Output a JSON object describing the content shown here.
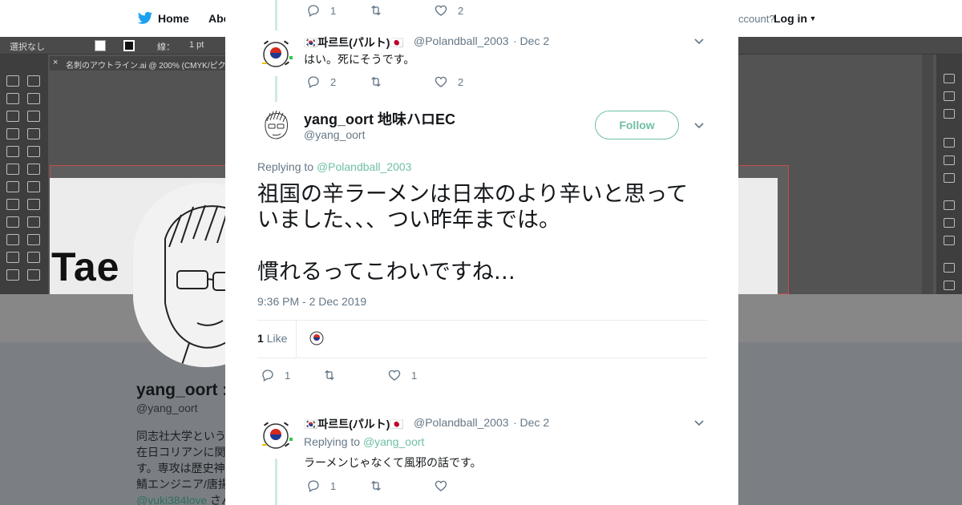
{
  "background": {
    "nav": {
      "home": "Home",
      "about": "Abo",
      "account_prompt": "ccount?",
      "login": "Log in"
    },
    "illustrator": {
      "option_label": "選択なし",
      "stroke_label": "線：",
      "stroke_value": "1 pt",
      "doc_tab": "名刺のアウトライン.ai @ 200% (CMYK/ピクセ",
      "art_text": "Tae"
    },
    "profile": {
      "name": "yang_oort :",
      "handle": "@yang_oort",
      "bio_lines": [
        "同志社大学という",
        "在日コリアンに関",
        "す。専攻は歴史神",
        "鯖エンジニア/唐揚"
      ],
      "bio_link": "@yuki384love",
      "bio_link_suffix": " さん"
    }
  },
  "modal": {
    "top_actions": {
      "replies": "1",
      "likes": "2"
    },
    "reply1": {
      "name": "🇰🇷파르트(パルト)🇯🇵",
      "handle": "@Polandball_2003",
      "date": "· Dec 2",
      "text": "はい。死にそうです。",
      "replies": "2",
      "likes": "2"
    },
    "main": {
      "name": "yang_oort 地味ハロEC",
      "handle": "@yang_oort",
      "follow": "Follow",
      "replying_prefix": "Replying to ",
      "replying_to": "@Polandball_2003",
      "text_line1": "祖国の辛ラーメンは日本のより辛いと思って",
      "text_line2": "いました、、、つい昨年までは。",
      "text_line3": "慣れるってこわいですね…",
      "timestamp": "9:36 PM - 2 Dec 2019",
      "like_count": "1",
      "like_label": "Like",
      "replies": "1",
      "likes": "1"
    },
    "reply2": {
      "name": "🇰🇷파르트(パルト)🇯🇵",
      "handle": "@Polandball_2003",
      "date": "· Dec 2",
      "replying_prefix": "Replying to ",
      "replying_to": "@yang_oort",
      "text": "ラーメンじゃなくて風邪の話です。",
      "replies": "1",
      "likes": ""
    }
  },
  "colors": {
    "accent": "#6fbfa4",
    "thread_line": "#ccebdf",
    "muted_text": "#657786",
    "twitter_blue": "#1da1f2"
  }
}
